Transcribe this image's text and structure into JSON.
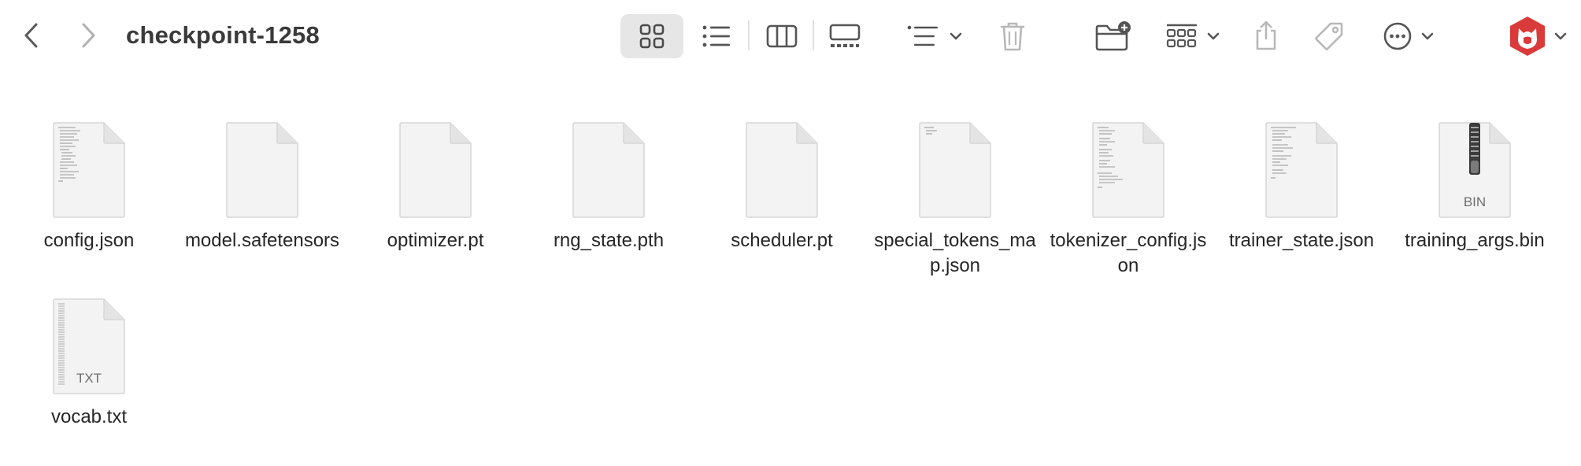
{
  "window": {
    "title": "checkpoint-1258"
  },
  "toolbar": {
    "back_icon": "chevron-left-icon",
    "forward_icon": "chevron-right-icon",
    "view_modes": [
      "icon-view",
      "list-view",
      "column-view",
      "gallery-view"
    ],
    "selected_view": "icon-view",
    "accent_color": "#d93a3a"
  },
  "files": [
    {
      "name": "config.json",
      "type": "text"
    },
    {
      "name": "model.safetensors",
      "type": "blank"
    },
    {
      "name": "optimizer.pt",
      "type": "blank"
    },
    {
      "name": "rng_state.pth",
      "type": "blank"
    },
    {
      "name": "scheduler.pt",
      "type": "blank"
    },
    {
      "name": "special_tokens_map.json",
      "type": "text-short"
    },
    {
      "name": "tokenizer_config.json",
      "type": "text"
    },
    {
      "name": "trainer_state.json",
      "type": "text"
    },
    {
      "name": "training_args.bin",
      "type": "bin",
      "badge": "BIN"
    },
    {
      "name": "vocab.txt",
      "type": "txt",
      "badge": "TXT"
    }
  ]
}
